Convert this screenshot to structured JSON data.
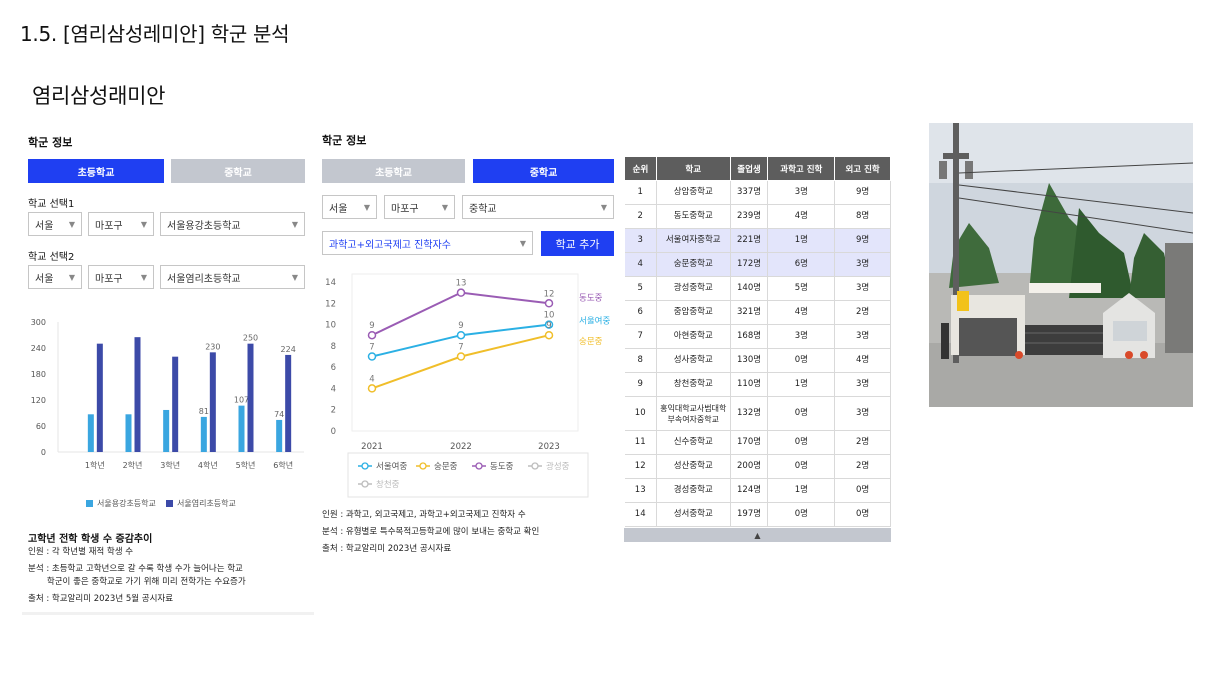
{
  "page": {
    "title": "1.5. [염리삼성레미안] 학군 분석",
    "section": "염리삼성래미안"
  },
  "elementary": {
    "panel_title": "학군 정보",
    "tabs": [
      "초등학교",
      "중학교"
    ],
    "select1_label": "학교 선택1",
    "select2_label": "학교 선택2",
    "select1": {
      "city": "서울",
      "district": "마포구",
      "school": "서울용강초등학교"
    },
    "select2": {
      "city": "서울",
      "district": "마포구",
      "school": "서울염리초등학교"
    },
    "note_head": "고학년 전학 학생 수 증감추이",
    "notes": [
      "인원 : 각 학년별 재적 학생 수",
      "분석 : 초등학교 고학년으로 갈 수록 학생 수가 늘어나는 학교",
      "       학군이 좋은 중학교로 가기 위해 미리 전학가는 수요증가",
      "출처 : 학교알리미 2023년 5월 공시자료"
    ]
  },
  "middle": {
    "panel_title": "학군 정보",
    "tabs": [
      "초등학교",
      "중학교"
    ],
    "select": {
      "city": "서울",
      "district": "마포구",
      "school": "중학교"
    },
    "metric": "과학고+외고국제고 진학자수",
    "add_button": "학교 추가",
    "notes": [
      "인원 : 과학고, 외고국제고, 과학고+외고국제고 진학자 수",
      "분석 : 유형별로 특수목적고등학교에 많이 보내는 중학교 확인",
      "출처 : 학교알리미 2023년 공시자료"
    ]
  },
  "table": {
    "headers": [
      "순위",
      "학교",
      "졸업생",
      "과학고 진학",
      "외고 진학"
    ],
    "rows": [
      [
        "1",
        "상암중학교",
        "337명",
        "3명",
        "9명"
      ],
      [
        "2",
        "동도중학교",
        "239명",
        "4명",
        "8명"
      ],
      [
        "3",
        "서울여자중학교",
        "221명",
        "1명",
        "9명"
      ],
      [
        "4",
        "숭문중학교",
        "172명",
        "6명",
        "3명"
      ],
      [
        "5",
        "광성중학교",
        "140명",
        "5명",
        "3명"
      ],
      [
        "6",
        "중암중학교",
        "321명",
        "4명",
        "2명"
      ],
      [
        "7",
        "아현중학교",
        "168명",
        "3명",
        "3명"
      ],
      [
        "8",
        "성사중학교",
        "130명",
        "0명",
        "4명"
      ],
      [
        "9",
        "창천중학교",
        "110명",
        "1명",
        "3명"
      ],
      [
        "10",
        "홍익대학교사범대학부속여자중학교",
        "132명",
        "0명",
        "3명"
      ],
      [
        "11",
        "신수중학교",
        "170명",
        "0명",
        "2명"
      ],
      [
        "12",
        "성산중학교",
        "200명",
        "0명",
        "2명"
      ],
      [
        "13",
        "경성중학교",
        "124명",
        "1명",
        "0명"
      ],
      [
        "14",
        "성서중학교",
        "197명",
        "0명",
        "0명"
      ]
    ],
    "highlight_rows": [
      2,
      3
    ],
    "footer_icon": "▲"
  },
  "chart_data": [
    {
      "type": "bar",
      "categories": [
        "1학년",
        "2학년",
        "3학년",
        "4학년",
        "5학년",
        "6학년"
      ],
      "series": [
        {
          "name": "서울용강초등학교",
          "color": "#3aa6e0",
          "values": [
            87,
            87,
            97,
            81,
            107,
            74
          ]
        },
        {
          "name": "서울염리초등학교",
          "color": "#3c4aa8",
          "values": [
            250,
            265,
            220,
            230,
            250,
            224
          ]
        }
      ],
      "yticks": [
        "0",
        "60",
        "120",
        "180",
        "240",
        "300"
      ],
      "ylim": [
        0,
        300
      ],
      "data_labels": {
        "서울용강초등학교": [
          "",
          "",
          "",
          "81",
          "107",
          "74"
        ],
        "서울염리초등학교": [
          "",
          "",
          "",
          "230",
          "250",
          "224"
        ]
      },
      "legend": "bottom"
    },
    {
      "type": "line",
      "categories": [
        "2021",
        "2022",
        "2023"
      ],
      "series": [
        {
          "name": "서울여중",
          "color": "#2bb0e4",
          "values": [
            7,
            9,
            10
          ],
          "end_label": "서울여중"
        },
        {
          "name": "숭문중",
          "color": "#f0be2a",
          "values": [
            4,
            7,
            9
          ],
          "end_label": "숭문중"
        },
        {
          "name": "동도중",
          "color": "#9a5cb4",
          "values": [
            9,
            13,
            12
          ],
          "end_label": "동도중"
        },
        {
          "name": "광성중",
          "color": "#bdbdbd",
          "values": [],
          "end_label": ""
        },
        {
          "name": "창천중",
          "color": "#bdbdbd",
          "values": [],
          "end_label": ""
        }
      ],
      "data_labels": {
        "서울여중": [
          "7",
          "9",
          "10"
        ],
        "숭문중": [
          "4",
          "7",
          "9"
        ],
        "동도중": [
          "9",
          "13",
          "12"
        ]
      },
      "yticks": [
        "0",
        "2",
        "4",
        "6",
        "8",
        "10",
        "12",
        "14"
      ],
      "ylim": [
        0,
        14
      ],
      "legend": "bottom"
    }
  ]
}
